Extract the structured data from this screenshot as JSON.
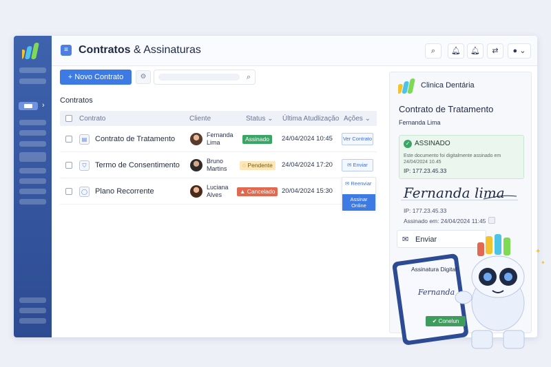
{
  "app": {
    "title_bold": "Contratos",
    "title_rest": " & Assinaturas"
  },
  "topbar": {
    "icons": [
      "search-icon",
      "bell-icon",
      "bell-icon",
      "translate-icon",
      "user-icon"
    ]
  },
  "toolbar": {
    "new_button": "+ Novo Contrato",
    "search_placeholder": ""
  },
  "section": {
    "label": "Contratos"
  },
  "table": {
    "headers": {
      "contract": "Contrato",
      "client": "Cliente",
      "status": "Status ⌄",
      "updated": "Última Atudlização",
      "actions": "Ações ⌄"
    },
    "rows": [
      {
        "name": "Contrato de Tratamento",
        "client_first": "Fernanda",
        "client_last": "Lima",
        "status": "Assinado",
        "date": "24/04/2024 10:45",
        "action": "Ver Contrato"
      },
      {
        "name": "Termo de Consentimento",
        "client_first": "Bruno",
        "client_last": "Martins",
        "status": "Pendente",
        "date": "24/04/2024 17:20",
        "action": "Enviar"
      },
      {
        "name": "Plano Recorrente",
        "client_first": "Luciana",
        "client_last": "Alves",
        "status": "Cancelado",
        "date": "20/04/2024 15:30",
        "action": ""
      }
    ],
    "menu": {
      "resend": "Reenviar",
      "sign_online": "Assinar Online"
    }
  },
  "colors": {
    "accent": "#3d7ae4",
    "sidebar": "#2d4b93",
    "signed": "#3ba566",
    "pending": "#f3b54a",
    "cancelled": "#e1694f"
  },
  "panel": {
    "clinic": "Clinica Dentária",
    "contract_title": "Contrato de Tratamento",
    "patient": "Fernanda Lima",
    "status": "ASSINADO",
    "note": "Este documento foi digitalmente assinado em 24/04/2024 10.45",
    "ip_box": "IP:  177.23.45.33",
    "signature": "Fernanda lima",
    "ip": "IP:  177.23.45.33",
    "signed_at": "Assinado em: 24/04/2024 11:45",
    "send": "Enviar"
  },
  "tablet": {
    "title": "Assinatura Digital",
    "signature": "Fernanda",
    "confirm": "Conelun"
  }
}
